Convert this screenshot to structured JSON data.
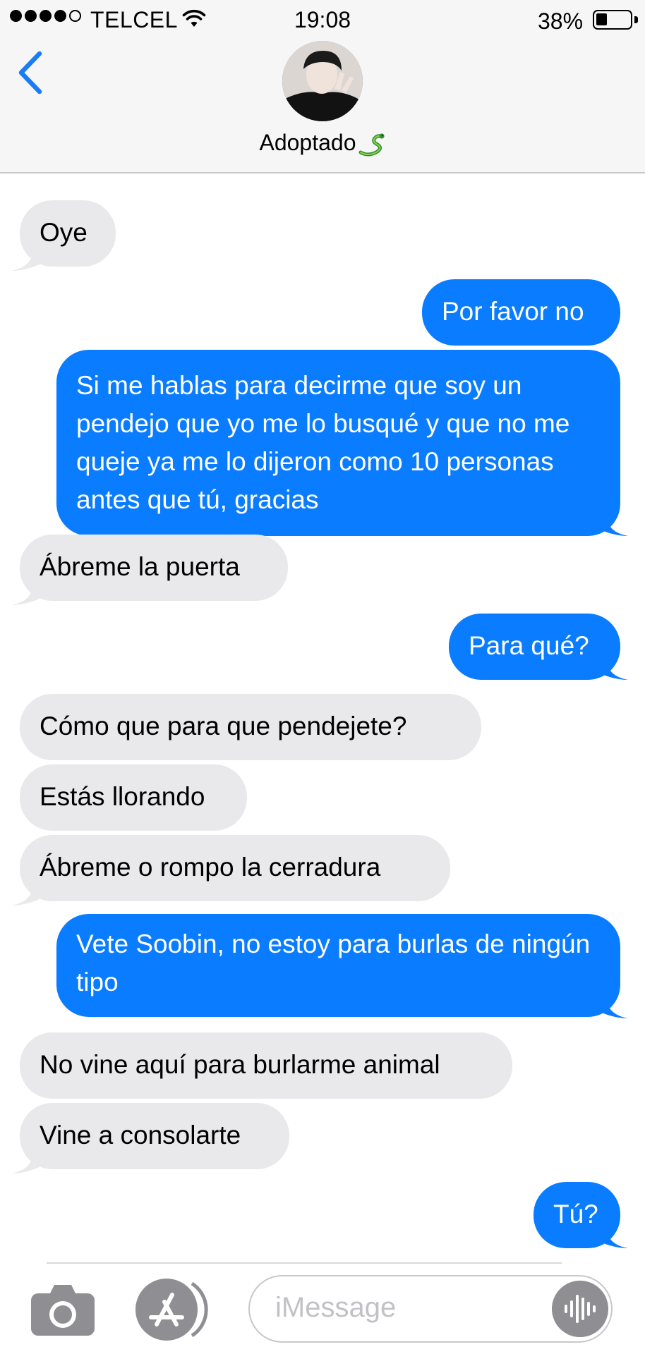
{
  "status_bar": {
    "carrier": "TELCEL",
    "time": "19:08",
    "battery_percent": "38%",
    "signal_bars_filled": 4,
    "signal_bars_total": 5
  },
  "header": {
    "back_icon": "chevron-left-icon",
    "contact_name": "Adoptado",
    "contact_emoji": "snake-icon"
  },
  "messages": [
    {
      "direction": "received",
      "text": "Oye"
    },
    {
      "direction": "sent",
      "text": "Por favor no"
    },
    {
      "direction": "sent",
      "text": "Si me hablas para decirme que soy un pendejo que yo me lo busqué y que no me queje ya me lo dijeron como 10 personas antes que tú, gracias"
    },
    {
      "direction": "received",
      "text": "Ábreme la puerta"
    },
    {
      "direction": "sent",
      "text": "Para qué?"
    },
    {
      "direction": "received",
      "text": "Cómo que para que pendejete?"
    },
    {
      "direction": "received",
      "text": "Estás llorando"
    },
    {
      "direction": "received",
      "text": "Ábreme o rompo la cerradura"
    },
    {
      "direction": "sent",
      "text": "Vete Soobin, no estoy para burlas de ningún tipo"
    },
    {
      "direction": "received",
      "text": "No vine aquí para burlarme animal"
    },
    {
      "direction": "received",
      "text": "Vine a consolarte"
    },
    {
      "direction": "sent",
      "text": "Tú?"
    }
  ],
  "input_bar": {
    "placeholder": "iMessage",
    "camera_icon": "camera-icon",
    "apps_icon": "app-store-icon",
    "audio_icon": "audio-waveform-icon"
  },
  "colors": {
    "sent_bubble": "#0a7cff",
    "received_bubble": "#e9e9eb",
    "accent": "#1a7cf5",
    "header_bg": "#f6f6f7"
  }
}
